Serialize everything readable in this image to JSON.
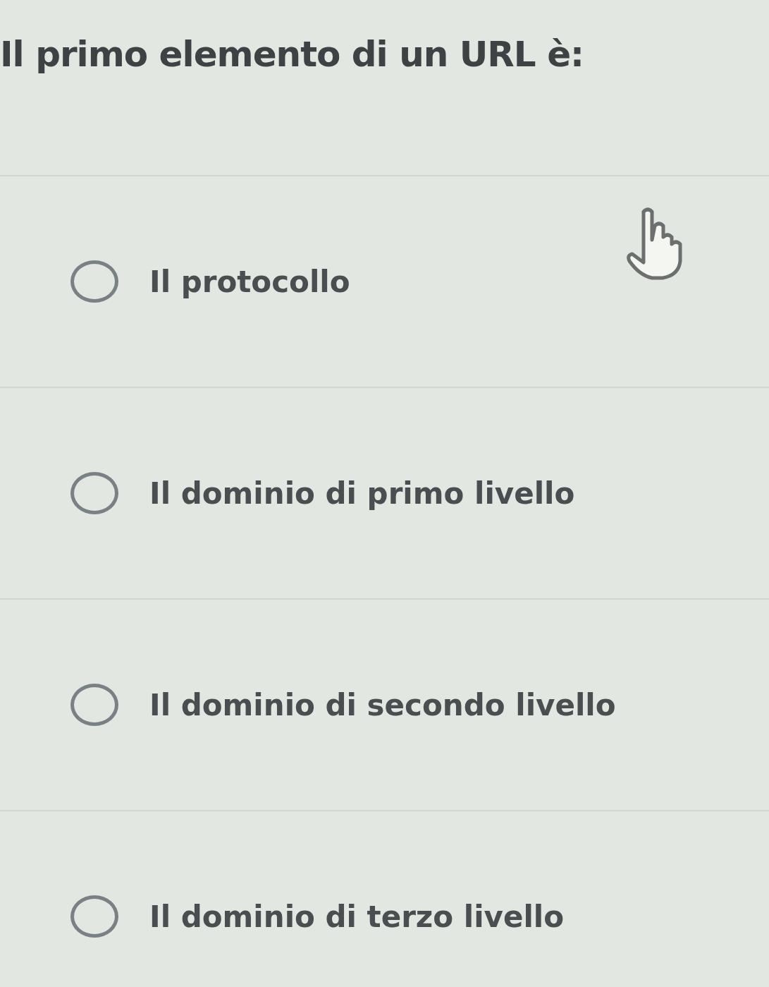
{
  "question": "Il primo elemento di un URL è:",
  "options": [
    {
      "label": "Il protocollo",
      "selected": false
    },
    {
      "label": "Il dominio di primo livello",
      "selected": false
    },
    {
      "label": "Il dominio di secondo livello",
      "selected": false
    },
    {
      "label": "Il dominio di terzo livello",
      "selected": false
    }
  ]
}
